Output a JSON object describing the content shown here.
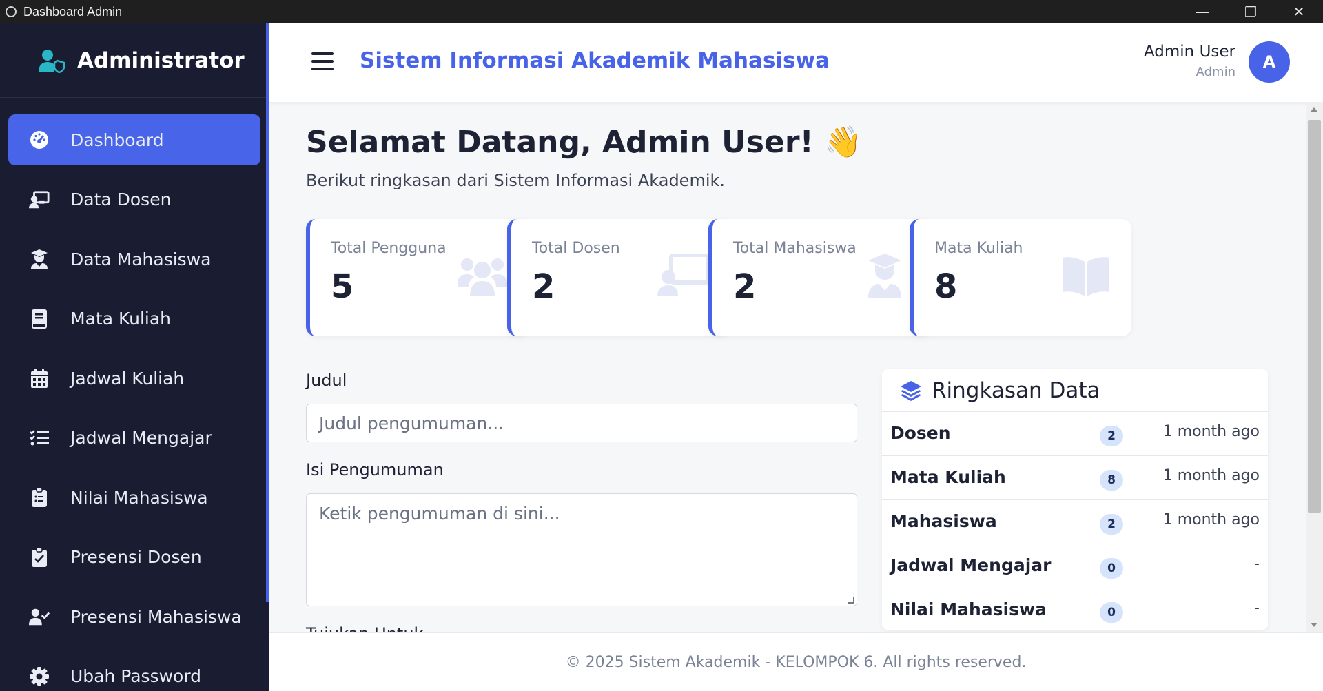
{
  "window": {
    "title": "Dashboard Admin",
    "controls": {
      "minimize": "—",
      "restore": "❐",
      "close": "✕"
    }
  },
  "sidebar": {
    "brand": "Administrator",
    "brand_icon": "user-shield-icon",
    "accent_color": "#4863e8",
    "items": [
      {
        "label": "Dashboard",
        "icon": "gauge-icon",
        "active": true
      },
      {
        "label": "Data Dosen",
        "icon": "chalkboard-teacher-icon"
      },
      {
        "label": "Data Mahasiswa",
        "icon": "user-graduate-icon"
      },
      {
        "label": "Mata Kuliah",
        "icon": "book-icon"
      },
      {
        "label": "Jadwal Kuliah",
        "icon": "calendar-icon"
      },
      {
        "label": "Jadwal Mengajar",
        "icon": "list-check-icon"
      },
      {
        "label": "Nilai Mahasiswa",
        "icon": "clipboard-list-icon"
      },
      {
        "label": "Presensi Dosen",
        "icon": "clipboard-check-icon"
      },
      {
        "label": "Presensi Mahasiswa",
        "icon": "user-check-icon"
      },
      {
        "label": "Ubah Password",
        "icon": "gear-icon"
      }
    ]
  },
  "header": {
    "app_title": "Sistem Informasi Akademik Mahasiswa",
    "user_name": "Admin User",
    "user_role": "Admin",
    "avatar_letter": "A"
  },
  "main": {
    "welcome": "Selamat Datang, Admin User!",
    "welcome_emoji": "👋",
    "subtitle": "Berikut ringkasan dari Sistem Informasi Akademik.",
    "stats": [
      {
        "label": "Total Pengguna",
        "value": "5",
        "icon": "users-icon"
      },
      {
        "label": "Total Dosen",
        "value": "2",
        "icon": "chalkboard-teacher-icon"
      },
      {
        "label": "Total Mahasiswa",
        "value": "2",
        "icon": "user-graduate-icon"
      },
      {
        "label": "Mata Kuliah",
        "value": "8",
        "icon": "book-open-icon"
      }
    ],
    "form": {
      "judul_label": "Judul",
      "judul_placeholder": "Judul pengumuman...",
      "isi_label": "Isi Pengumuman",
      "isi_placeholder": "Ketik pengumuman di sini...",
      "tujuan_label": "Tujukan Untuk"
    },
    "summary": {
      "title": "Ringkasan Data",
      "icon": "layer-group-icon",
      "rows": [
        {
          "name": "Dosen",
          "count": "2",
          "time": "1 month ago"
        },
        {
          "name": "Mata Kuliah",
          "count": "8",
          "time": "1 month ago"
        },
        {
          "name": "Mahasiswa",
          "count": "2",
          "time": "1 month ago"
        },
        {
          "name": "Jadwal Mengajar",
          "count": "0",
          "time": "-"
        },
        {
          "name": "Nilai Mahasiswa",
          "count": "0",
          "time": "-"
        }
      ]
    }
  },
  "footer": {
    "text": "© 2025 Sistem Akademik - KELOMPOK 6. All rights reserved."
  }
}
